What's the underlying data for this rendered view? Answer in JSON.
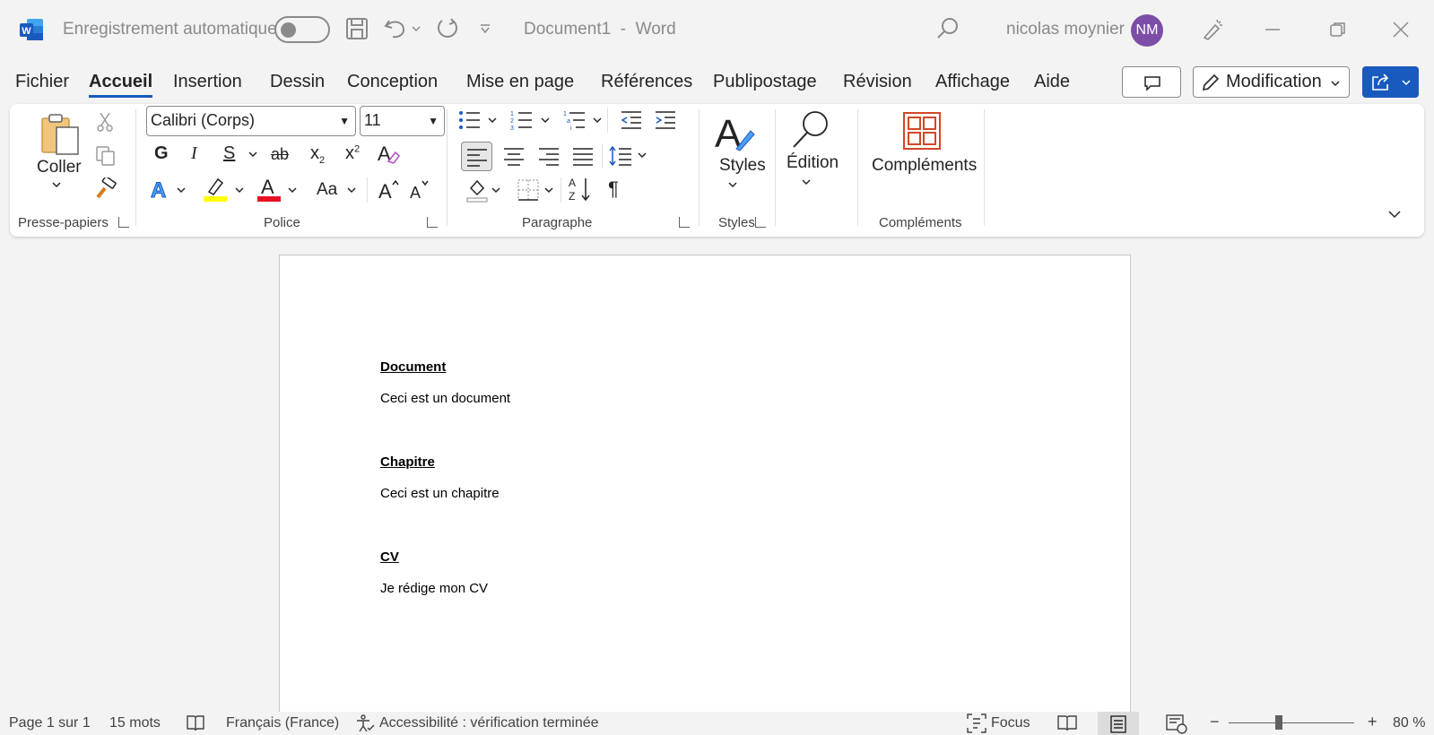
{
  "titlebar": {
    "autosave_label": "Enregistrement automatique",
    "doc_title": "Document1  -  Word",
    "user_name": "nicolas moynier",
    "avatar_initials": "NM"
  },
  "menu": {
    "tabs": [
      "Fichier",
      "Accueil",
      "Insertion",
      "Dessin",
      "Conception",
      "Mise en page",
      "Références",
      "Publipostage",
      "Révision",
      "Affichage",
      "Aide"
    ],
    "active_tab": "Accueil",
    "modification_label": "Modification"
  },
  "ribbon": {
    "paste_label": "Coller",
    "font_name": "Calibri (Corps)",
    "font_size": "11",
    "bold_glyph": "G",
    "italic_glyph": "I",
    "underline_glyph": "S",
    "strike_glyph": "ab",
    "subscript_glyph": "x",
    "superscript_glyph": "x",
    "case_glyph": "Aa",
    "styles_label": "Styles",
    "edition_label": "Édition",
    "addins_label": "Compléments",
    "groups": {
      "clipboard": "Presse-papiers",
      "font": "Police",
      "paragraph": "Paragraphe",
      "styles": "Styles",
      "addins": "Compléments"
    },
    "colors": {
      "highlight": "#ffff00",
      "font_color": "#e81123",
      "accent": "#185abd",
      "addins_icon": "#d24726"
    }
  },
  "document": {
    "h1": "Document",
    "p1": "Ceci est un document",
    "h2": "Chapitre",
    "p2": "Ceci est un chapitre",
    "h3": "CV",
    "p3": "Je rédige mon CV"
  },
  "status": {
    "page": "Page 1 sur 1",
    "words": "15 mots",
    "language": "Français (France)",
    "accessibility": "Accessibilité : vérification terminée",
    "focus": "Focus",
    "zoom": "80 %"
  }
}
